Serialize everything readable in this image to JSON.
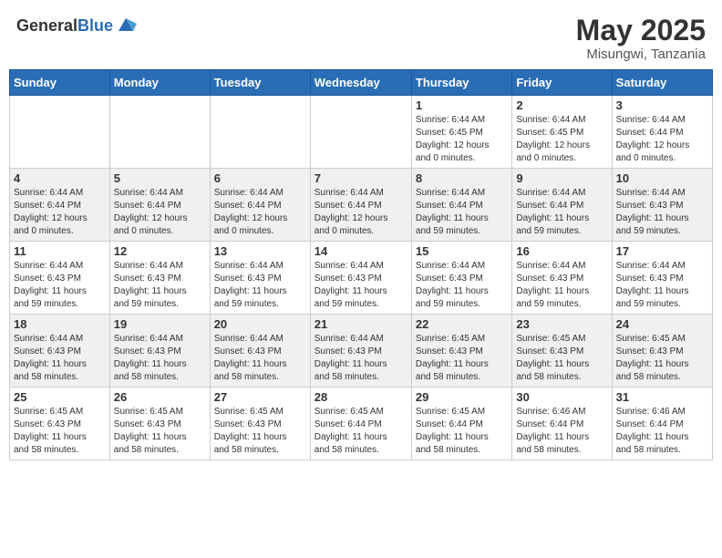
{
  "logo": {
    "general": "General",
    "blue": "Blue"
  },
  "title": {
    "month_year": "May 2025",
    "location": "Misungwi, Tanzania"
  },
  "weekdays": [
    "Sunday",
    "Monday",
    "Tuesday",
    "Wednesday",
    "Thursday",
    "Friday",
    "Saturday"
  ],
  "weeks": [
    [
      {
        "day": "",
        "info": ""
      },
      {
        "day": "",
        "info": ""
      },
      {
        "day": "",
        "info": ""
      },
      {
        "day": "",
        "info": ""
      },
      {
        "day": "1",
        "info": "Sunrise: 6:44 AM\nSunset: 6:45 PM\nDaylight: 12 hours\nand 0 minutes."
      },
      {
        "day": "2",
        "info": "Sunrise: 6:44 AM\nSunset: 6:45 PM\nDaylight: 12 hours\nand 0 minutes."
      },
      {
        "day": "3",
        "info": "Sunrise: 6:44 AM\nSunset: 6:44 PM\nDaylight: 12 hours\nand 0 minutes."
      }
    ],
    [
      {
        "day": "4",
        "info": "Sunrise: 6:44 AM\nSunset: 6:44 PM\nDaylight: 12 hours\nand 0 minutes."
      },
      {
        "day": "5",
        "info": "Sunrise: 6:44 AM\nSunset: 6:44 PM\nDaylight: 12 hours\nand 0 minutes."
      },
      {
        "day": "6",
        "info": "Sunrise: 6:44 AM\nSunset: 6:44 PM\nDaylight: 12 hours\nand 0 minutes."
      },
      {
        "day": "7",
        "info": "Sunrise: 6:44 AM\nSunset: 6:44 PM\nDaylight: 12 hours\nand 0 minutes."
      },
      {
        "day": "8",
        "info": "Sunrise: 6:44 AM\nSunset: 6:44 PM\nDaylight: 11 hours\nand 59 minutes."
      },
      {
        "day": "9",
        "info": "Sunrise: 6:44 AM\nSunset: 6:44 PM\nDaylight: 11 hours\nand 59 minutes."
      },
      {
        "day": "10",
        "info": "Sunrise: 6:44 AM\nSunset: 6:43 PM\nDaylight: 11 hours\nand 59 minutes."
      }
    ],
    [
      {
        "day": "11",
        "info": "Sunrise: 6:44 AM\nSunset: 6:43 PM\nDaylight: 11 hours\nand 59 minutes."
      },
      {
        "day": "12",
        "info": "Sunrise: 6:44 AM\nSunset: 6:43 PM\nDaylight: 11 hours\nand 59 minutes."
      },
      {
        "day": "13",
        "info": "Sunrise: 6:44 AM\nSunset: 6:43 PM\nDaylight: 11 hours\nand 59 minutes."
      },
      {
        "day": "14",
        "info": "Sunrise: 6:44 AM\nSunset: 6:43 PM\nDaylight: 11 hours\nand 59 minutes."
      },
      {
        "day": "15",
        "info": "Sunrise: 6:44 AM\nSunset: 6:43 PM\nDaylight: 11 hours\nand 59 minutes."
      },
      {
        "day": "16",
        "info": "Sunrise: 6:44 AM\nSunset: 6:43 PM\nDaylight: 11 hours\nand 59 minutes."
      },
      {
        "day": "17",
        "info": "Sunrise: 6:44 AM\nSunset: 6:43 PM\nDaylight: 11 hours\nand 59 minutes."
      }
    ],
    [
      {
        "day": "18",
        "info": "Sunrise: 6:44 AM\nSunset: 6:43 PM\nDaylight: 11 hours\nand 58 minutes."
      },
      {
        "day": "19",
        "info": "Sunrise: 6:44 AM\nSunset: 6:43 PM\nDaylight: 11 hours\nand 58 minutes."
      },
      {
        "day": "20",
        "info": "Sunrise: 6:44 AM\nSunset: 6:43 PM\nDaylight: 11 hours\nand 58 minutes."
      },
      {
        "day": "21",
        "info": "Sunrise: 6:44 AM\nSunset: 6:43 PM\nDaylight: 11 hours\nand 58 minutes."
      },
      {
        "day": "22",
        "info": "Sunrise: 6:45 AM\nSunset: 6:43 PM\nDaylight: 11 hours\nand 58 minutes."
      },
      {
        "day": "23",
        "info": "Sunrise: 6:45 AM\nSunset: 6:43 PM\nDaylight: 11 hours\nand 58 minutes."
      },
      {
        "day": "24",
        "info": "Sunrise: 6:45 AM\nSunset: 6:43 PM\nDaylight: 11 hours\nand 58 minutes."
      }
    ],
    [
      {
        "day": "25",
        "info": "Sunrise: 6:45 AM\nSunset: 6:43 PM\nDaylight: 11 hours\nand 58 minutes."
      },
      {
        "day": "26",
        "info": "Sunrise: 6:45 AM\nSunset: 6:43 PM\nDaylight: 11 hours\nand 58 minutes."
      },
      {
        "day": "27",
        "info": "Sunrise: 6:45 AM\nSunset: 6:43 PM\nDaylight: 11 hours\nand 58 minutes."
      },
      {
        "day": "28",
        "info": "Sunrise: 6:45 AM\nSunset: 6:44 PM\nDaylight: 11 hours\nand 58 minutes."
      },
      {
        "day": "29",
        "info": "Sunrise: 6:45 AM\nSunset: 6:44 PM\nDaylight: 11 hours\nand 58 minutes."
      },
      {
        "day": "30",
        "info": "Sunrise: 6:46 AM\nSunset: 6:44 PM\nDaylight: 11 hours\nand 58 minutes."
      },
      {
        "day": "31",
        "info": "Sunrise: 6:46 AM\nSunset: 6:44 PM\nDaylight: 11 hours\nand 58 minutes."
      }
    ]
  ]
}
